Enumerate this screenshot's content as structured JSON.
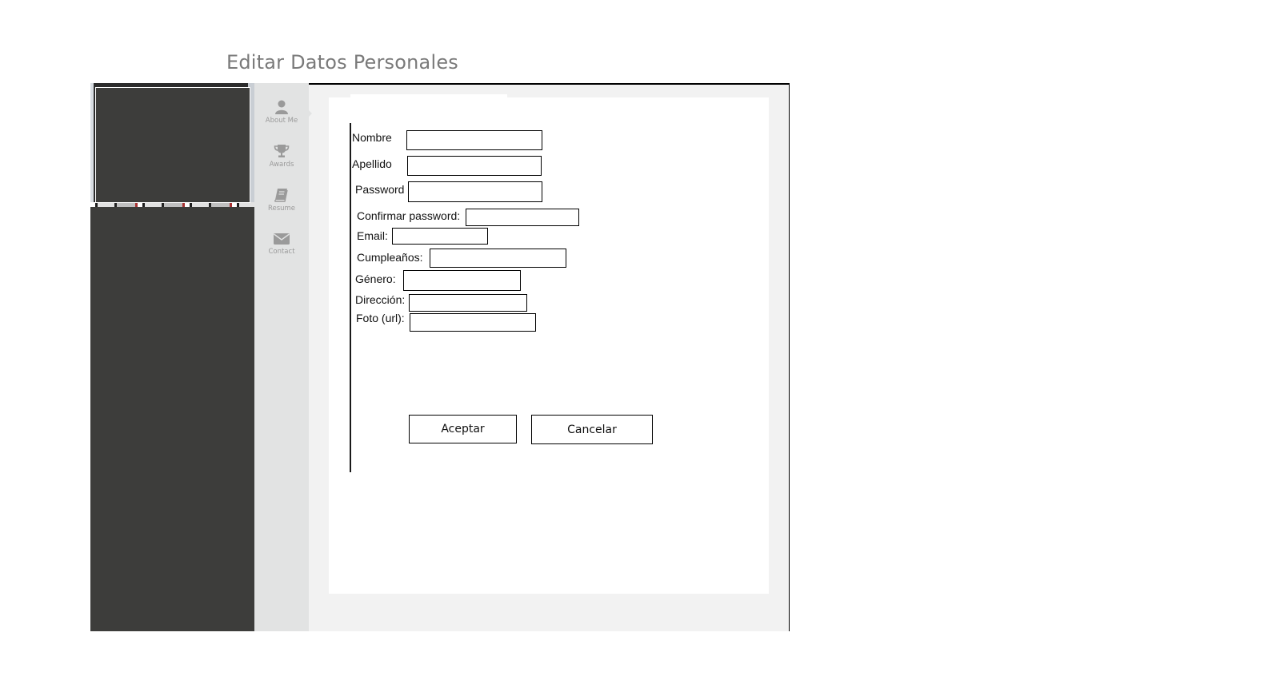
{
  "page": {
    "title": "Editar Datos Personales"
  },
  "nav": {
    "items": [
      {
        "label": "About Me",
        "icon": "user-icon"
      },
      {
        "label": "Awards",
        "icon": "trophy-icon"
      },
      {
        "label": "Resume",
        "icon": "book-icon"
      },
      {
        "label": "Contact",
        "icon": "envelope-icon"
      }
    ]
  },
  "form": {
    "nombre_label": "Nombre",
    "apellido_label": "Apellido",
    "password_label": "Password",
    "confirmar_label": "Confirmar password:",
    "email_label": "Email:",
    "cumple_label": "Cumpleaños:",
    "genero_label": "Género:",
    "direccion_label": "Dirección:",
    "foto_label": "Foto (url):",
    "nombre_value": "",
    "apellido_value": "",
    "password_value": "",
    "confirmar_value": "",
    "email_value": "",
    "cumple_value": "",
    "genero_value": "",
    "direccion_value": "",
    "foto_value": ""
  },
  "buttons": {
    "aceptar": "Aceptar",
    "cancelar": "Cancelar"
  },
  "colors": {
    "sidebar_dark": "#3d3d3b",
    "nav_bg": "#e2e3e3",
    "frame_bg": "#f2f2f2",
    "title_gray": "#7a7a7a",
    "icon_gray": "#9a9a9a"
  }
}
